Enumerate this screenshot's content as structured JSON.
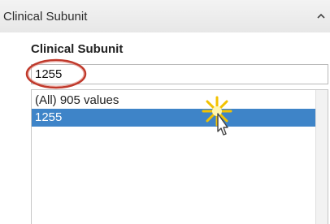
{
  "panel": {
    "title": "Clinical Subunit",
    "collapse_icon": "chevron-up-icon"
  },
  "filter": {
    "label": "Clinical Subunit",
    "input_value": "1255",
    "list": [
      {
        "label": "(All) 905 values",
        "selected": false
      },
      {
        "label": "1255",
        "selected": true
      }
    ]
  },
  "colors": {
    "selection": "#3e84c8",
    "highlight_circle": "#c0392b",
    "sparkle": "#f2c200"
  }
}
